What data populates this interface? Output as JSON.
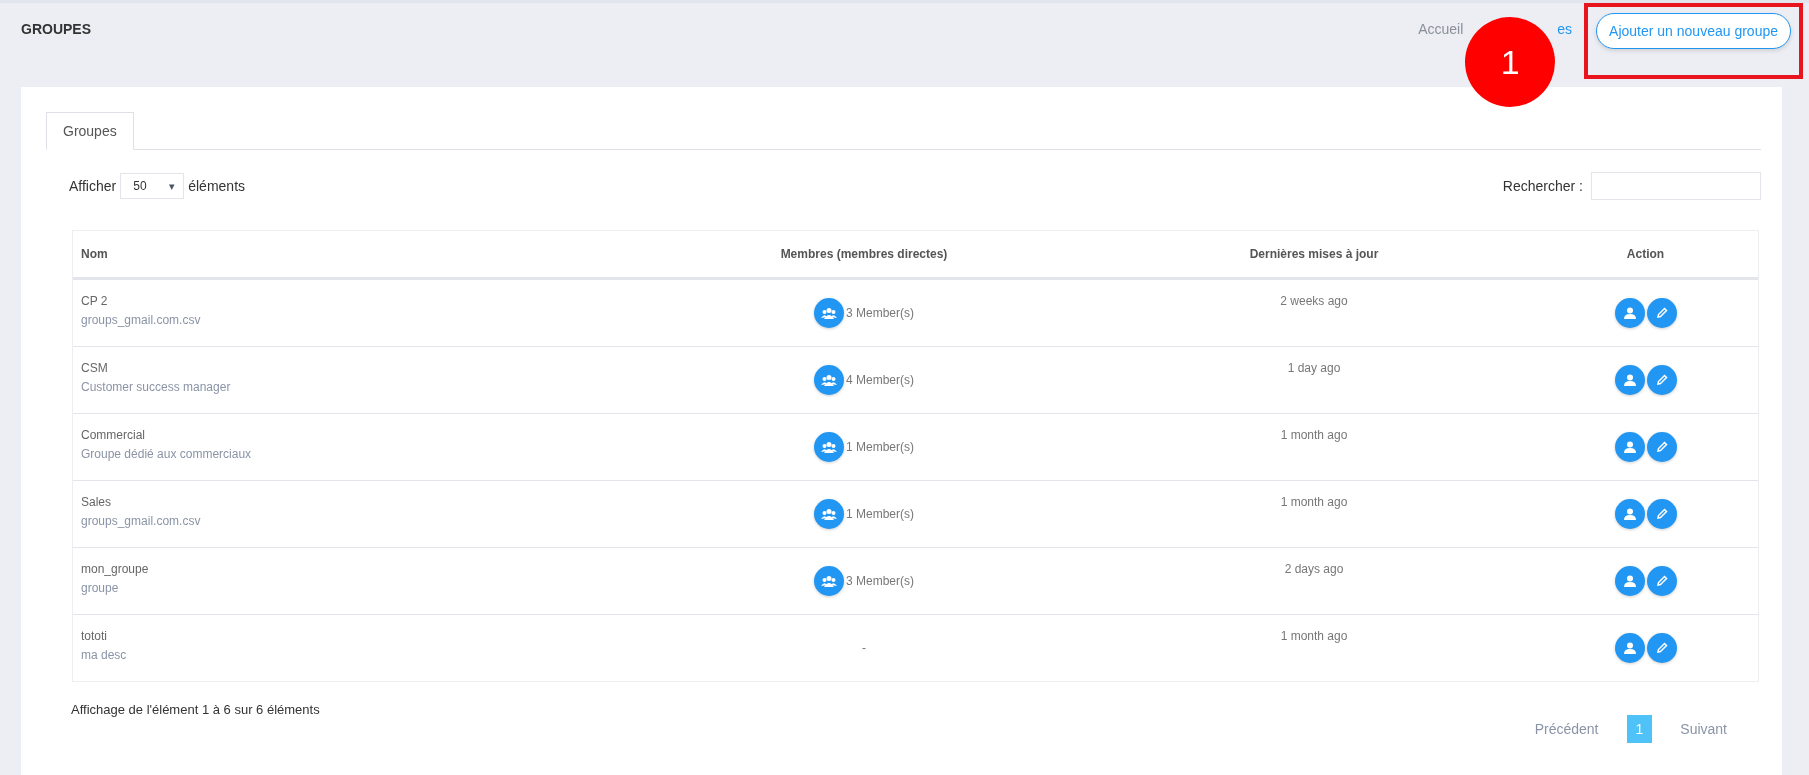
{
  "page_title": "GROUPES",
  "breadcrumb": [
    {
      "label": "Accueil",
      "link": false
    },
    {
      "label": "es",
      "link": true
    }
  ],
  "add_button": {
    "label": "Ajouter un nouveau groupe",
    "highlighted": true
  },
  "annotation": {
    "number": "1"
  },
  "tabs": [
    {
      "label": "Groupes",
      "selected": true
    }
  ],
  "length": {
    "before": "Afficher",
    "value": "50",
    "caret": "▾",
    "after": "éléments"
  },
  "search": {
    "label": "Rechercher :"
  },
  "table": {
    "columns": [
      "Nom",
      "Membres (membres directes)",
      "Dernières mises à jour",
      "Action"
    ],
    "rows": [
      {
        "name": "CP 2",
        "description": "groups_gmail.com.csv",
        "members": "3 Member(s)",
        "members_icon": true,
        "updated": "2 weeks ago"
      },
      {
        "name": "CSM",
        "description": "Customer success manager",
        "members": "4 Member(s)",
        "members_icon": true,
        "updated": "1 day ago"
      },
      {
        "name": "Commercial",
        "description": "Groupe dédié aux commerciaux",
        "members": "1 Member(s)",
        "members_icon": true,
        "updated": "1 month ago"
      },
      {
        "name": "Sales",
        "description": "groups_gmail.com.csv",
        "members": "1 Member(s)",
        "members_icon": true,
        "updated": "1 month ago"
      },
      {
        "name": "mon_groupe",
        "description": "groupe",
        "members": "3 Member(s)",
        "members_icon": true,
        "updated": "2 days ago"
      },
      {
        "name": "tototi",
        "description": "ma desc",
        "members": "-",
        "members_icon": false,
        "updated": "1 month ago"
      }
    ]
  },
  "info": "Affichage de l'élément 1 à 6 sur 6 éléments",
  "pagination": [
    {
      "label": "Précédent",
      "kind": "prev",
      "selected": false
    },
    {
      "label": "1",
      "kind": "page",
      "selected": true
    },
    {
      "label": "Suivant",
      "kind": "next",
      "selected": false
    }
  ]
}
